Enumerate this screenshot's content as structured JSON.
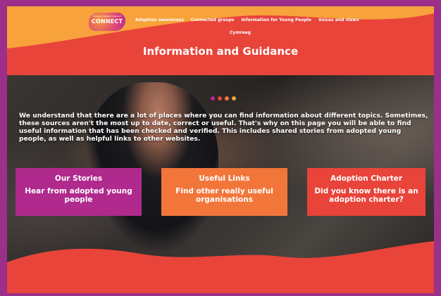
{
  "logo": {
    "text": "CONNECT",
    "tagline": "Adoption Support Connect"
  },
  "nav": {
    "items": [
      {
        "label": "Adoption awareness"
      },
      {
        "label": "Connected groups"
      },
      {
        "label": "Information for Young People"
      },
      {
        "label": "Voices and views"
      }
    ],
    "second_row": "Cymraeg"
  },
  "page": {
    "title": "Information and Guidance",
    "intro": "We understand that there are a lot of places where you can find information about different topics. Sometimes, these sources aren't the most up to date, correct or useful. That's why on this page you will be able to find useful information that has been checked and verified. This includes shared stories from adopted young people, as well as helpful links to other websites."
  },
  "slider": {
    "dot_colors": [
      "#b02a8d",
      "#e8443a",
      "#f2763a",
      "#f7a23a"
    ]
  },
  "cards": [
    {
      "title": "Our Stories",
      "text": "Hear from adopted young people",
      "color": "#b02a8d"
    },
    {
      "title": "Useful Links",
      "text": "Find other really useful organisations",
      "color": "#f2763a"
    },
    {
      "title": "Adoption Charter",
      "text": "Did you know there is an adoption charter?",
      "color": "#e8443a"
    }
  ],
  "colors": {
    "page_border": "#9b2f8a",
    "header_yellow": "#f7a23a",
    "header_red": "#e8443a"
  }
}
